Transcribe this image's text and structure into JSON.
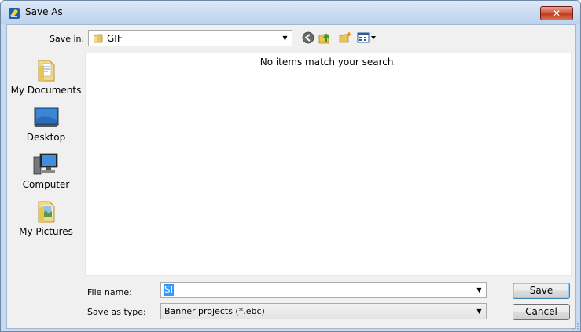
{
  "window": {
    "title": "Save As",
    "close_label": "✕"
  },
  "toolbar": {
    "save_in_label": "Save in:",
    "save_in_value": "GIF",
    "icons": [
      "back-icon",
      "up-folder-icon",
      "new-folder-icon",
      "view-menu-icon"
    ]
  },
  "sidebar": {
    "items": [
      {
        "label": "My Documents",
        "icon": "my-documents-icon"
      },
      {
        "label": "Desktop",
        "icon": "desktop-icon"
      },
      {
        "label": "Computer",
        "icon": "computer-icon"
      },
      {
        "label": "My Pictures",
        "icon": "my-pictures-icon"
      }
    ]
  },
  "file_list": {
    "empty_message": "No items match your search."
  },
  "form": {
    "file_name_label": "File name:",
    "file_name_value": "SI",
    "save_type_label": "Save as type:",
    "save_type_value": "Banner projects (*.ebc)"
  },
  "buttons": {
    "save": "Save",
    "cancel": "Cancel"
  },
  "colors": {
    "selection": "#3399ff",
    "frame": "#c8daf0",
    "close_button": "#c74a32"
  }
}
